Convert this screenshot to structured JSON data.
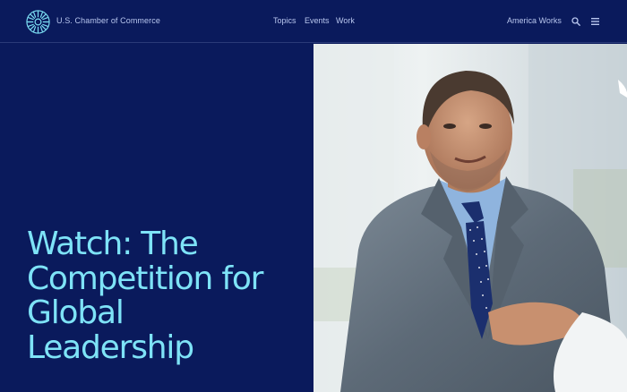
{
  "header": {
    "brand": "U.S. Chamber of Commerce",
    "logo_icon": "uscc-radial-logo-icon",
    "nav": [
      {
        "label": "Topics"
      },
      {
        "label": "Events"
      },
      {
        "label": "Work"
      }
    ],
    "america_works": "America Works",
    "search_icon": "search-icon",
    "menu_icon": "hamburger-menu-icon"
  },
  "hero": {
    "title": "Watch: The Competition for Global Leadership",
    "image": "photo of smiling businessman in grey suit and polka-dot tie"
  },
  "colors": {
    "navy": "#0a1a5c",
    "accent_cyan": "#7ee3f7",
    "nav_text": "#b8c6ee"
  }
}
